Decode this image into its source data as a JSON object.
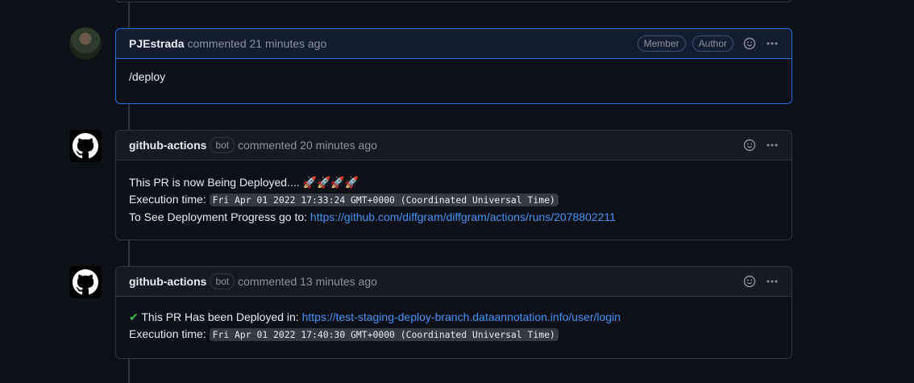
{
  "comments": [
    {
      "author": "PJEstrada",
      "meta": "commented 21 minutes ago",
      "labels": [
        "Member",
        "Author"
      ],
      "body": "/deploy"
    },
    {
      "author": "github-actions",
      "bot": "bot",
      "meta": "commented 20 minutes ago",
      "line1": "This PR is now Being Deployed.... 🚀🚀🚀🚀",
      "exec_label": "Execution time:",
      "exec_value": "Fri Apr 01 2022 17:33:24 GMT+0000 (Coordinated Universal Time)",
      "progress_label": "To See Deployment Progress go to:",
      "progress_link": "https://github.com/diffgram/diffgram/actions/runs/2078802211"
    },
    {
      "author": "github-actions",
      "bot": "bot",
      "meta": "commented 13 minutes ago",
      "check": "✔",
      "deployed_label": "This PR Has been Deployed in:",
      "deployed_link": "https://test-staging-deploy-branch.dataannotation.info/user/login",
      "exec_label": "Execution time:",
      "exec_value": "Fri Apr 01 2022 17:40:30 GMT+0000 (Coordinated Universal Time)"
    }
  ],
  "icons": {
    "emoji": "smiley-icon",
    "menu": "kebab-horizontal-icon",
    "github": "github-logo-icon"
  },
  "colors": {
    "link": "#4493f8",
    "check": "#3fb950",
    "highlight_border": "#1f6feb"
  }
}
